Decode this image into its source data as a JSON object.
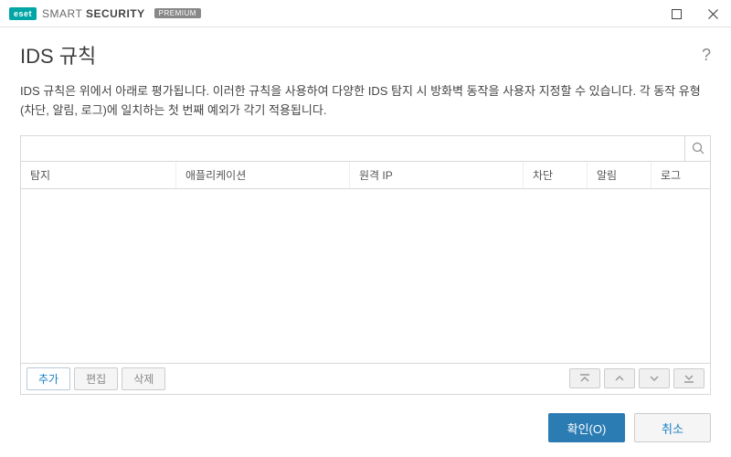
{
  "brand": {
    "badge": "eset",
    "name_light": "SMART",
    "name_bold": "SECURITY",
    "edition": "PREMIUM"
  },
  "page": {
    "title": "IDS 규칙",
    "description": "IDS 규칙은 위에서 아래로 평가됩니다. 이러한 규칙을 사용하여 다양한 IDS 탐지 시 방화벽 동작을 사용자 지정할 수 있습니다. 각 동작 유형(차단, 알림, 로그)에 일치하는 첫 번째 예외가 각기 적용됩니다."
  },
  "search": {
    "placeholder": ""
  },
  "columns": {
    "detect": "탐지",
    "application": "애플리케이션",
    "remote_ip": "원격 IP",
    "block": "차단",
    "notify": "알림",
    "log": "로그"
  },
  "rows": [],
  "actions": {
    "add": "추가",
    "edit": "편집",
    "delete": "삭제"
  },
  "footer": {
    "ok": "확인(O)",
    "cancel": "취소"
  }
}
